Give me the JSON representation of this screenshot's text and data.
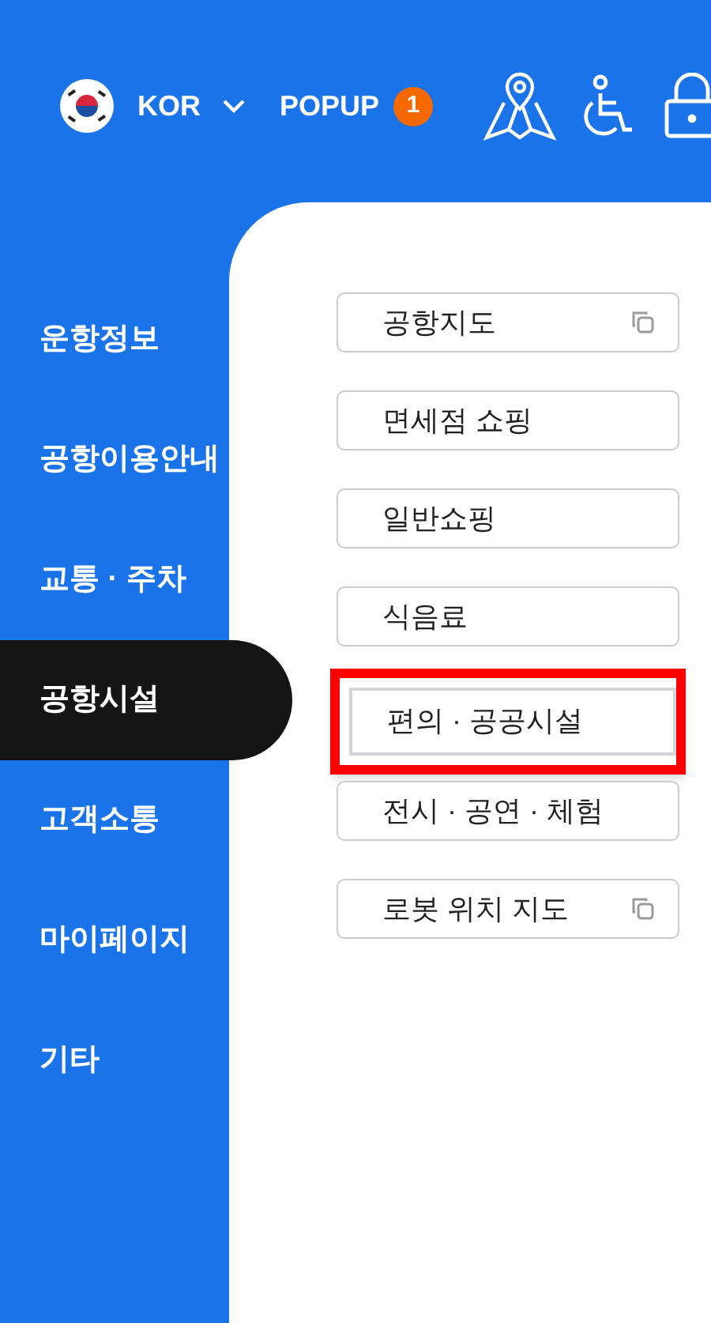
{
  "header": {
    "language": "KOR",
    "popup": {
      "label": "POPUP",
      "count": "1"
    }
  },
  "nav": [
    {
      "label": "운항정보",
      "selected": false
    },
    {
      "label": "공항이용안내",
      "selected": false
    },
    {
      "label": "교통 · 주차",
      "selected": false
    },
    {
      "label": "공항시설",
      "selected": true
    },
    {
      "label": "고객소통",
      "selected": false
    },
    {
      "label": "마이페이지",
      "selected": false
    },
    {
      "label": "기타",
      "selected": false
    }
  ],
  "submenu": [
    {
      "label": "공항지도",
      "new_window": true,
      "highlighted": false
    },
    {
      "label": "면세점 쇼핑",
      "new_window": false,
      "highlighted": false
    },
    {
      "label": "일반쇼핑",
      "new_window": false,
      "highlighted": false
    },
    {
      "label": "식음료",
      "new_window": false,
      "highlighted": false
    },
    {
      "label": "편의 · 공공시설",
      "new_window": false,
      "highlighted": true
    },
    {
      "label": "전시 · 공연 · 체험",
      "new_window": false,
      "highlighted": false
    },
    {
      "label": "로봇 위치 지도",
      "new_window": true,
      "highlighted": false
    }
  ]
}
